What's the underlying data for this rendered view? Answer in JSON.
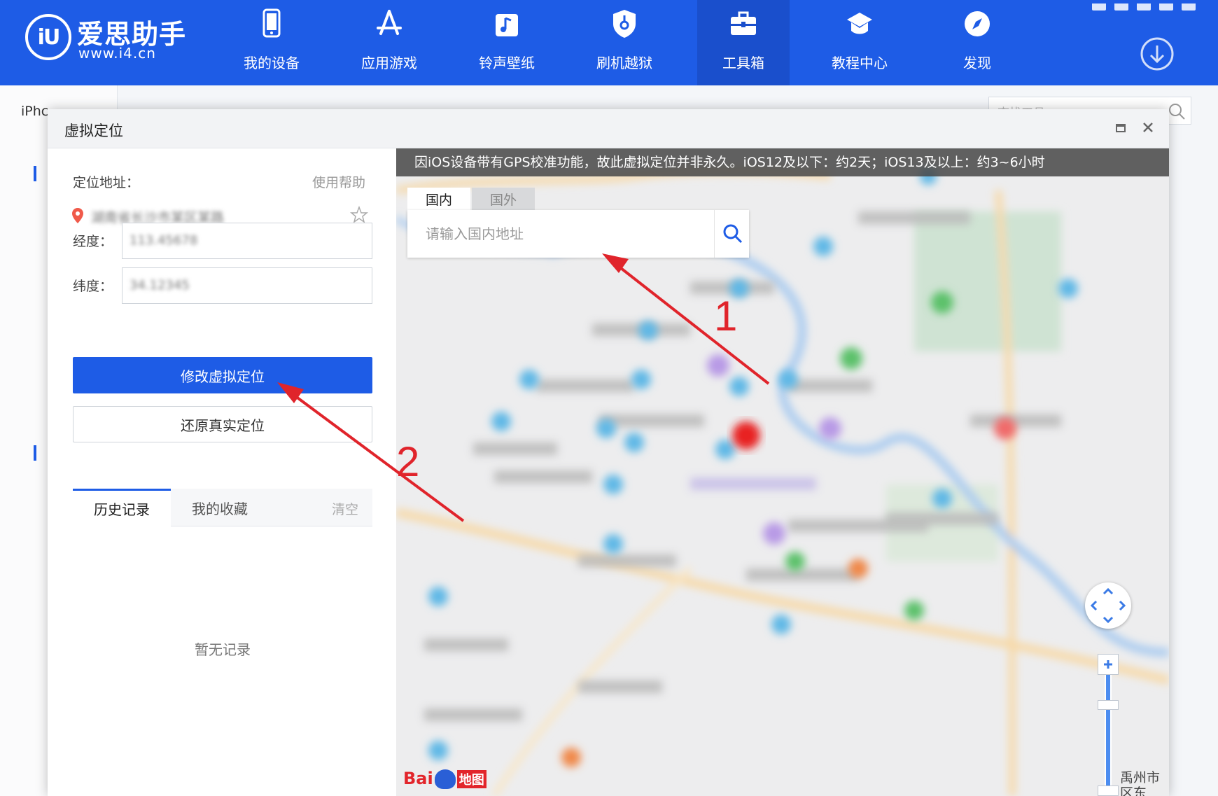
{
  "app": {
    "logo_name": "爱思助手",
    "logo_url": "www.i4.cn",
    "logo_mark": "iU"
  },
  "nav": [
    {
      "label": "我的设备",
      "icon": "phone-icon"
    },
    {
      "label": "应用游戏",
      "icon": "app-store-icon"
    },
    {
      "label": "铃声壁纸",
      "icon": "music-note-icon"
    },
    {
      "label": "刷机越狱",
      "icon": "shield-key-icon"
    },
    {
      "label": "工具箱",
      "icon": "toolbox-icon",
      "active": true
    },
    {
      "label": "教程中心",
      "icon": "graduation-cap-icon"
    },
    {
      "label": "发现",
      "icon": "compass-icon"
    }
  ],
  "background": {
    "device_label": "iPhc",
    "search_placeholder": "查找工具"
  },
  "dialog": {
    "title": "虚拟定位",
    "address_label": "定位地址：",
    "help_link": "使用帮助",
    "address_value": "湖南省长沙市某区某路",
    "longitude_label": "经度：",
    "longitude_value": "113.45678",
    "latitude_label": "纬度：",
    "latitude_value": "34.12345",
    "modify_button": "修改虚拟定位",
    "restore_button": "还原真实定位",
    "tab_history": "历史记录",
    "tab_favorites": "我的收藏",
    "clear_button": "清空",
    "empty_text": "暂无记录"
  },
  "map": {
    "notice": "因iOS设备带有GPS校准功能，故此虚拟定位并非永久。iOS12及以下：约2天；iOS13及以上：约3~6小时",
    "tab_domestic": "国内",
    "tab_foreign": "国外",
    "search_placeholder": "请输入国内地址",
    "baidu_text": "Bai",
    "baidu_map_text": "地图",
    "city_label_1": "禹州市",
    "city_label_2": "区东"
  },
  "annotations": {
    "arrow_1_label": "1",
    "arrow_2_label": "2",
    "arrow_color": "#e0242b"
  },
  "colors": {
    "brand_blue": "#1e5ce6",
    "active_nav": "#1a4fcc"
  }
}
